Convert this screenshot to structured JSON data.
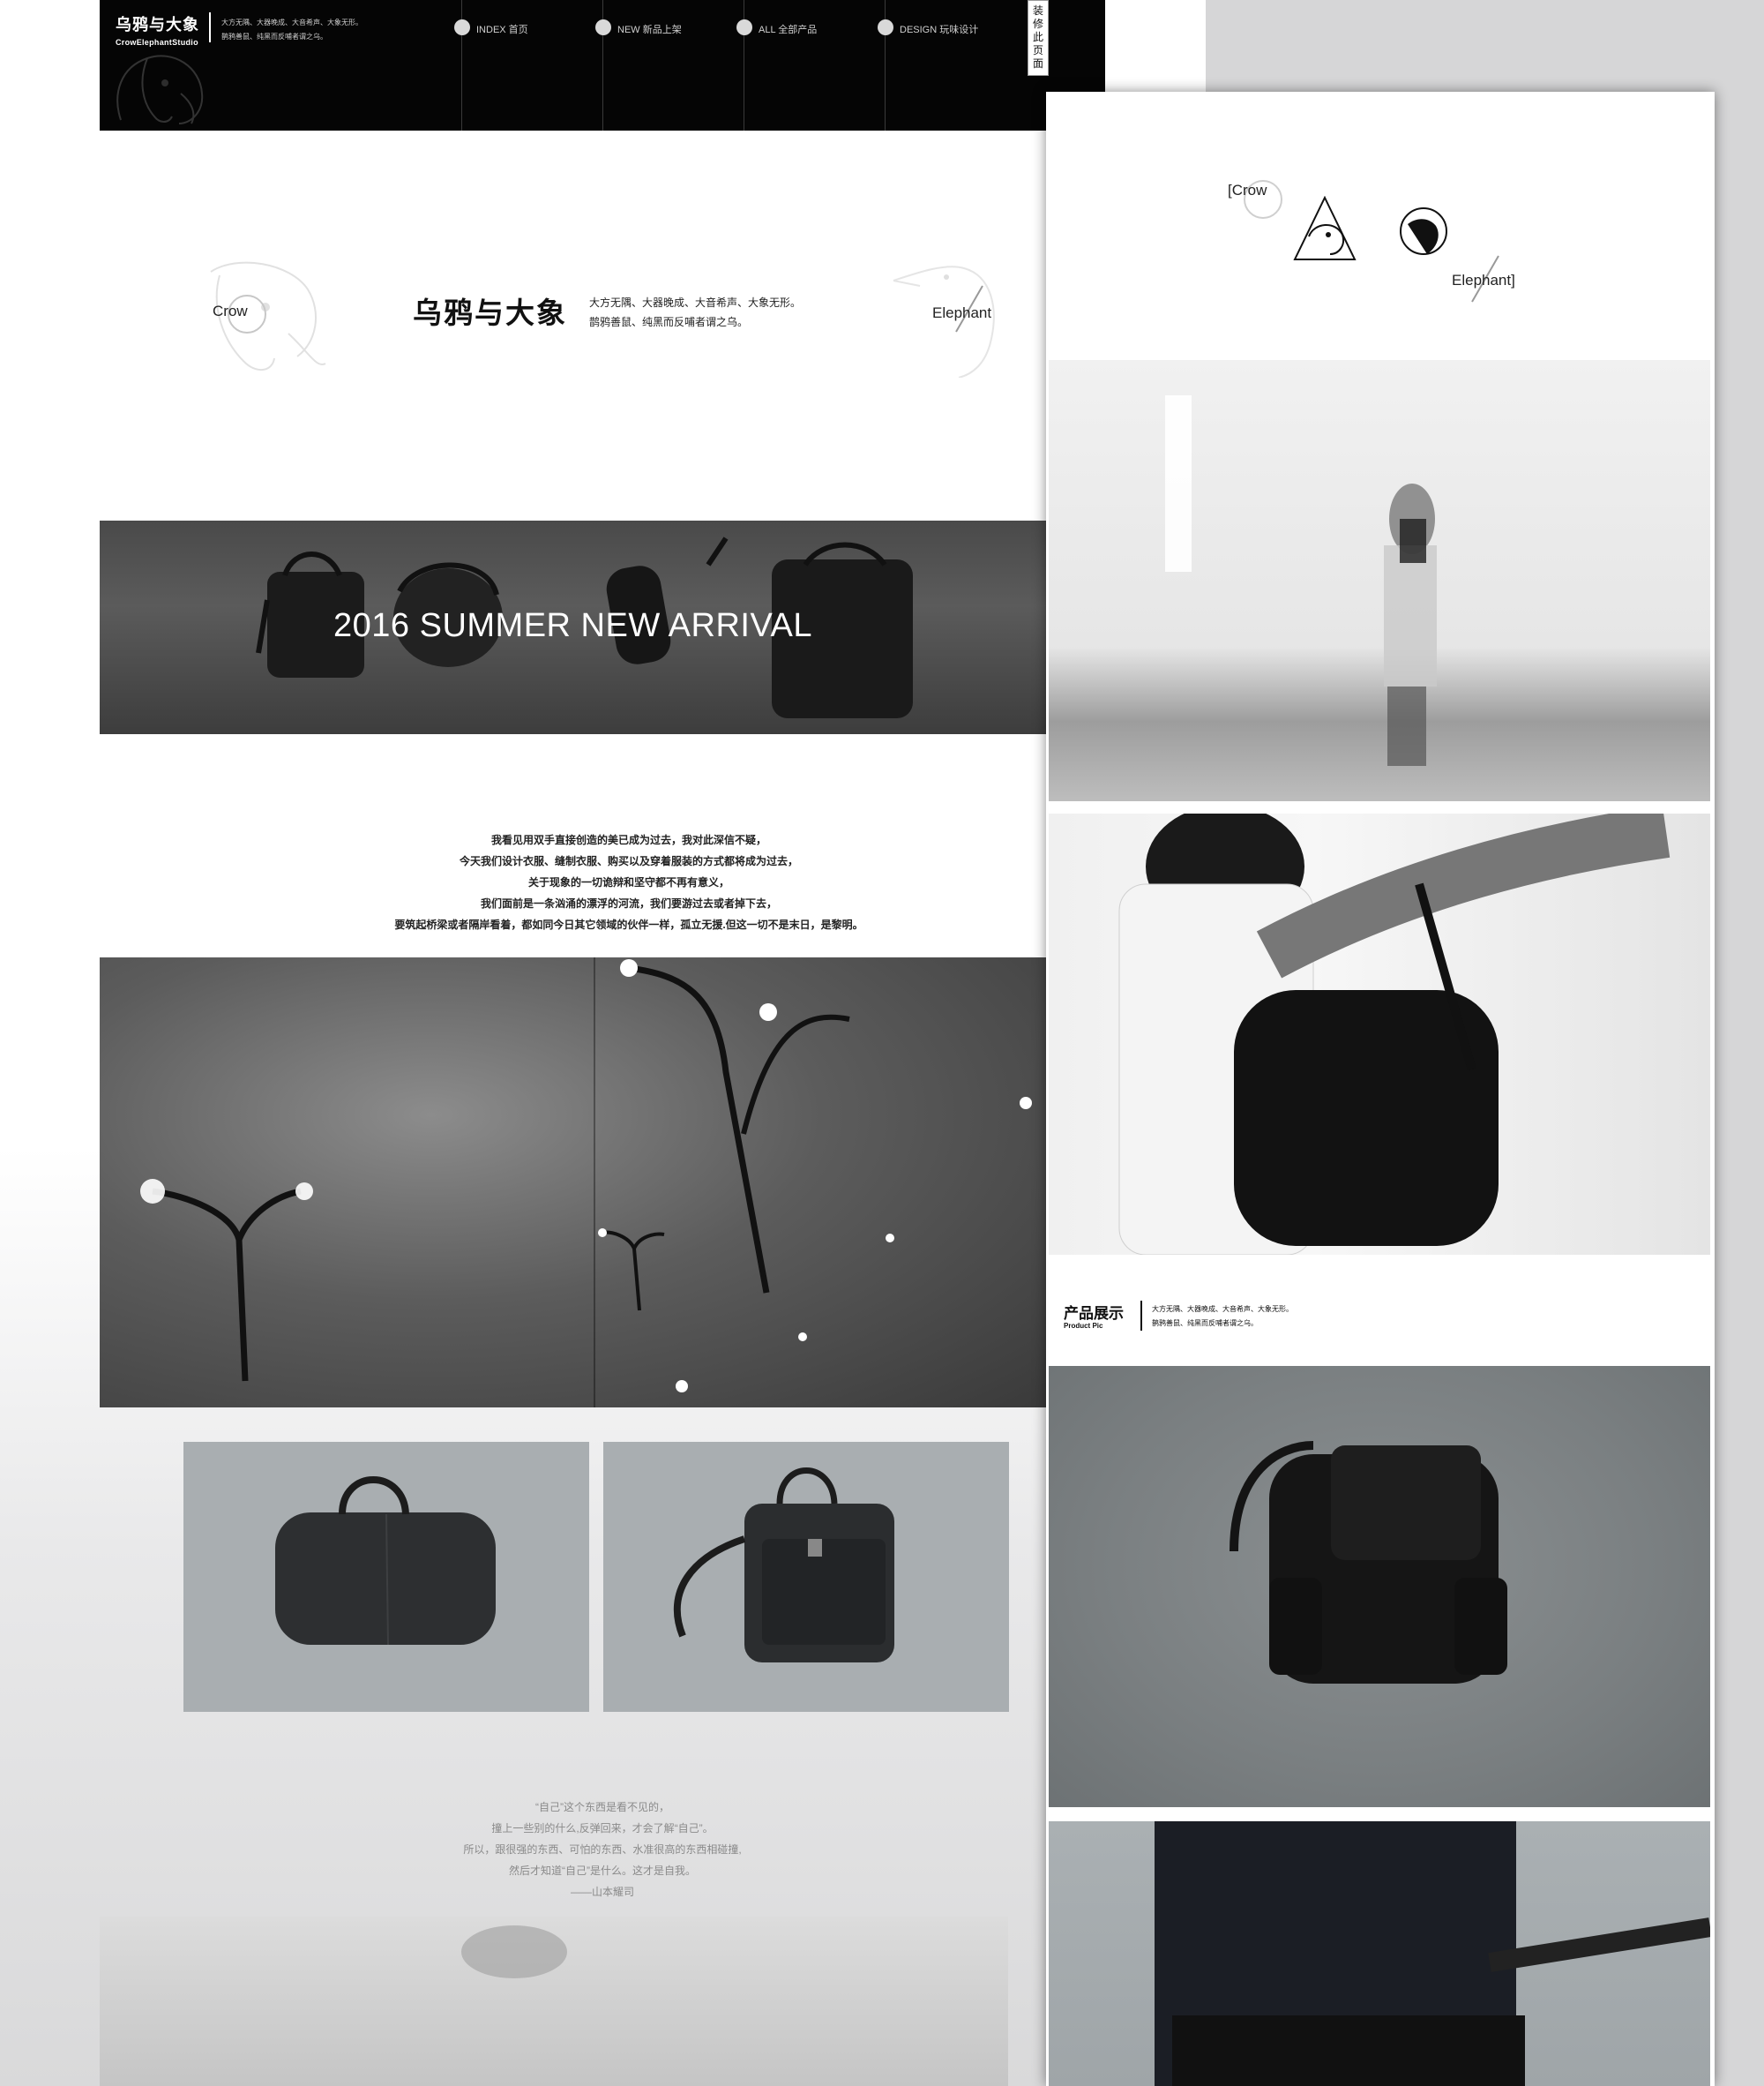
{
  "nav": {
    "brand_cn": "乌鸦与大象",
    "brand_en": "CrowElephantStudio",
    "tagline": [
      "大方无隅、大器晚成、大音希声、大象无形。",
      "鹊鸦善鼠、纯黑而反哺者谓之乌。"
    ],
    "items": [
      {
        "label": "INDEX 首页"
      },
      {
        "label": "NEW 新品上架"
      },
      {
        "label": "ALL 全部产品"
      },
      {
        "label": "DESIGN 玩味设计"
      }
    ],
    "edit_label": "装修此页面"
  },
  "hero": {
    "crow_label": "Crow",
    "title": "乌鸦与大象",
    "tagline": [
      "大方无隅、大器晚成、大音希声、大象无形。",
      "鹊鸦善鼠、纯黑而反哺者谓之乌。"
    ],
    "elephant_label": "Elephant"
  },
  "banner": {
    "title": "2016 SUMMER NEW ARRIVAL"
  },
  "quote1": [
    "我看见用双手直接创造的美已成为过去，我对此深信不疑，",
    "今天我们设计衣服、缝制衣服、购买以及穿着服装的方式都将成为过去，",
    "关于现象的一切诡辩和坚守都不再有意义，",
    "我们面前是一条汹涌的漂浮的河流，我们要游过去或者掉下去，",
    "要筑起桥梁或者隔岸看着，都如同今日其它领域的伙伴一样，孤立无援.但这一切不是末日，是黎明。"
  ],
  "quote2": [
    "“自己”这个东西是看不见的，",
    "撞上一些别的什么,反弹回来，才会了解“自己”。",
    "所以，跟很强的东西、可怕的东西、水准很高的东西相碰撞,",
    "然后才知道“自己”是什么。这才是自我。",
    "——山本耀司"
  ],
  "right": {
    "crow_label": "[Crow",
    "elephant_label": "Elephant]",
    "product_title": "产品展示",
    "product_sub": "Product Pic",
    "product_tagline": [
      "大方无隅、大器晚成、大音希声、大象无形。",
      "鹊鸦善鼠、纯黑而反哺者谓之乌。"
    ]
  },
  "colors": {
    "nav_bg": "#050505",
    "page_bg": "#ffffff",
    "side_gray": "#d6d6d7",
    "banner_bg": "#4a4a4a",
    "concrete": "#a9aeb1"
  }
}
